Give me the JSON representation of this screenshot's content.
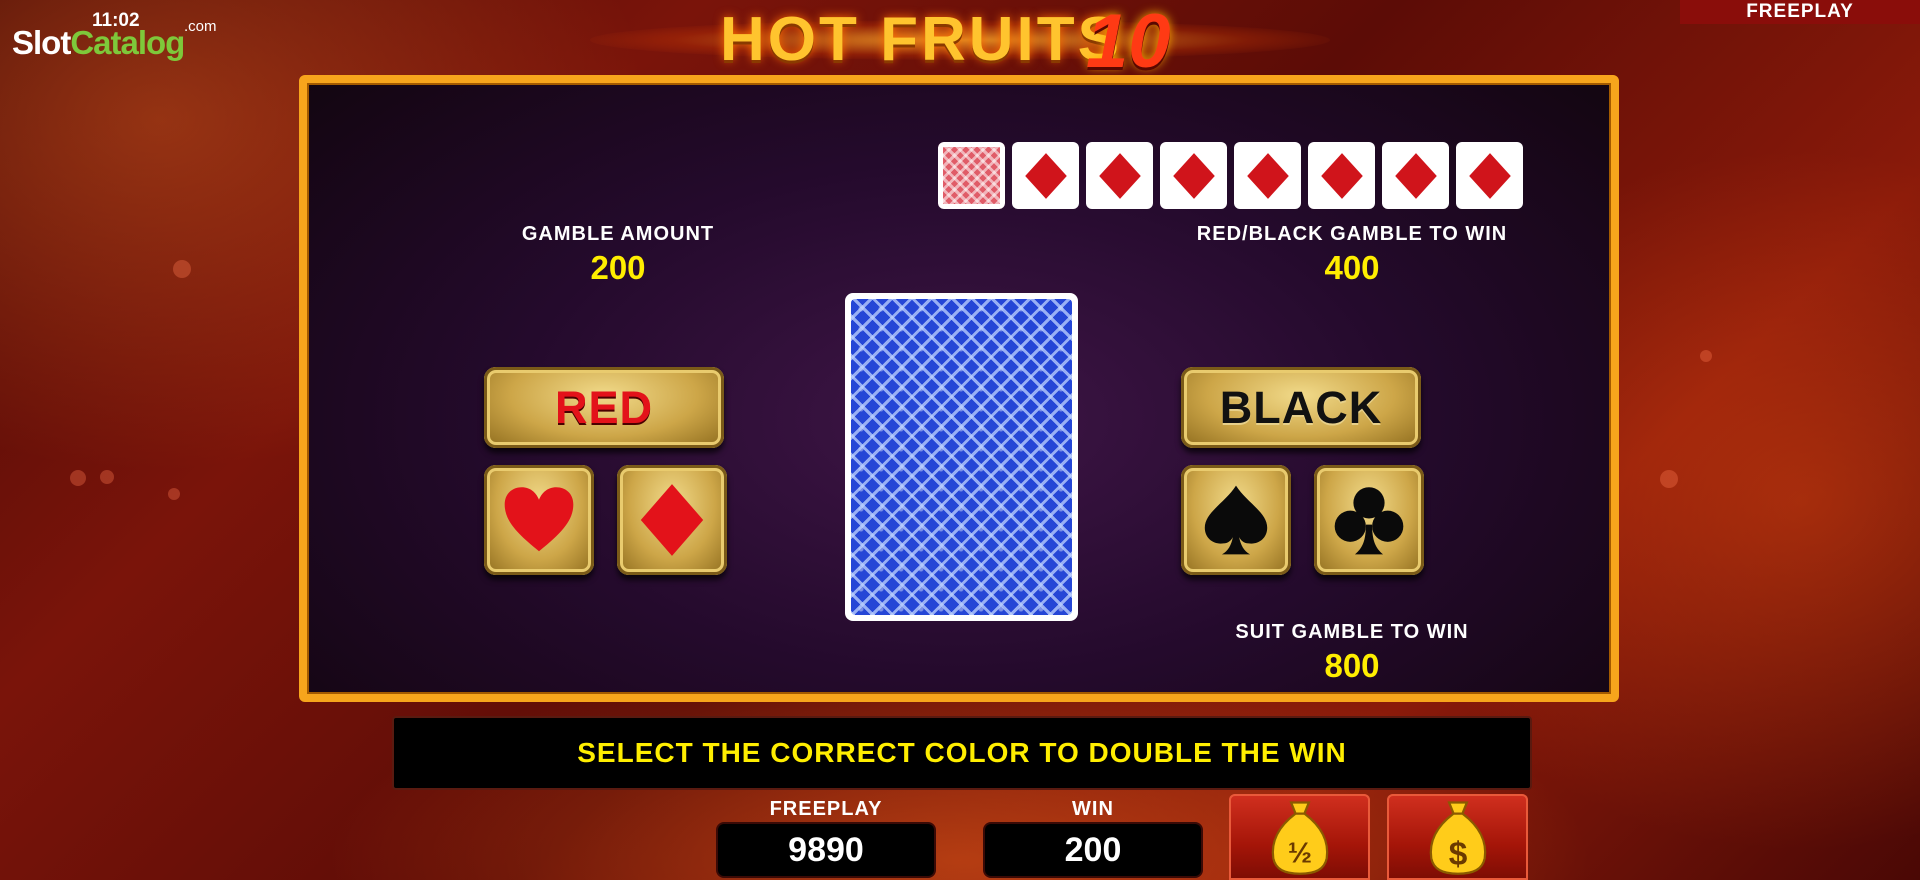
{
  "watermark": {
    "time": "11:02",
    "brand_slot": "Slot",
    "brand_catalog": "Catalog",
    "brand_com": ".com"
  },
  "top_bar": {
    "mode_label": "FREEPLAY"
  },
  "title": {
    "text": "HOT FRUITS",
    "number": "10"
  },
  "history": {
    "cards": [
      {
        "type": "card-back",
        "icon": "card-back-icon"
      },
      {
        "type": "diamond",
        "icon": "diamond-icon"
      },
      {
        "type": "diamond",
        "icon": "diamond-icon"
      },
      {
        "type": "diamond",
        "icon": "diamond-icon"
      },
      {
        "type": "diamond",
        "icon": "diamond-icon"
      },
      {
        "type": "diamond",
        "icon": "diamond-icon"
      },
      {
        "type": "diamond",
        "icon": "diamond-icon"
      },
      {
        "type": "diamond",
        "icon": "diamond-icon"
      }
    ]
  },
  "gamble": {
    "amount_label": "GAMBLE AMOUNT",
    "amount_value": "200",
    "color_win_label": "RED/BLACK GAMBLE TO WIN",
    "color_win_value": "400",
    "suit_win_label": "SUIT GAMBLE TO WIN",
    "suit_win_value": "800"
  },
  "buttons": {
    "red_label": "RED",
    "black_label": "BLACK",
    "suits": [
      "heart-icon",
      "diamond-icon",
      "spade-icon",
      "club-icon"
    ]
  },
  "message": "SELECT THE CORRECT COLOR TO DOUBLE THE WIN",
  "footer": {
    "freeplay_label": "FREEPLAY",
    "freeplay_value": "9890",
    "win_label": "WIN",
    "win_value": "200",
    "half_collect_icon": "money-bag-half-icon",
    "collect_icon": "money-bag-dollar-icon"
  },
  "colors": {
    "accent": "#f7a51c",
    "value_yellow": "#ffee00",
    "suit_red": "#e3121a",
    "panel_bg": "#240a2c"
  }
}
